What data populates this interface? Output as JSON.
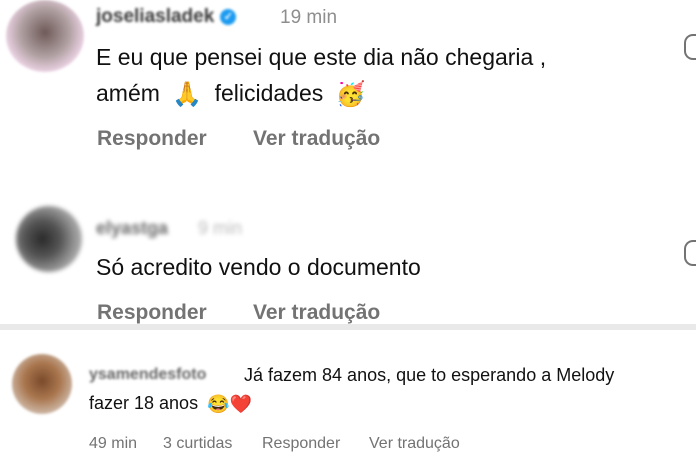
{
  "comments": [
    {
      "username": "joseliasladek",
      "time": "19 min",
      "text_line1": "E eu que pensei que este dia não chegaria ,",
      "text_line2_a": "amém",
      "text_line2_b": "felicidades",
      "emoji_a": "🙏",
      "emoji_b": "🥳",
      "reply_label": "Responder",
      "translate_label": "Ver tradução"
    },
    {
      "username": "elyastga",
      "time": "9 min",
      "text": "Só acredito vendo o documento",
      "reply_label": "Responder",
      "translate_label": "Ver tradução"
    },
    {
      "username": "ysamendesfoto",
      "text_line1": "Já fazem 84 anos, que to esperando a Melody",
      "text_line2": "fazer 18 anos",
      "emoji_a": "😂",
      "emoji_b": "❤️",
      "time": "49 min",
      "likes": "3 curtidas",
      "reply_label": "Responder",
      "translate_label": "Ver tradução"
    }
  ],
  "colors": {
    "verified_badge": "#1d9bf0",
    "text": "#111111",
    "meta": "#737373"
  },
  "icons": [
    "verified-badge-icon",
    "praying-hands-emoji",
    "party-face-emoji",
    "tears-of-joy-emoji",
    "red-heart-emoji",
    "heart-outline-icon"
  ]
}
